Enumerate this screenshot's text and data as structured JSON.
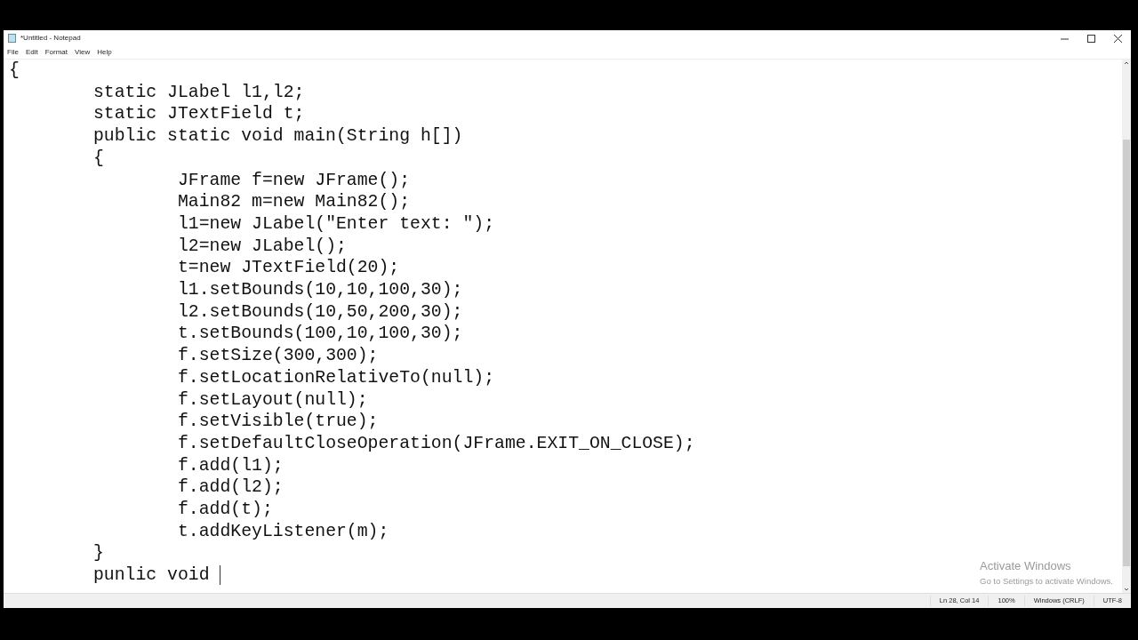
{
  "window": {
    "title": "*Untitled - Notepad"
  },
  "menu": [
    "File",
    "Edit",
    "Format",
    "View",
    "Help"
  ],
  "editor": {
    "lines": [
      "{",
      "\tstatic JLabel l1,l2;",
      "\tstatic JTextField t;",
      "\tpublic static void main(String h[])",
      "\t{",
      "\t\tJFrame f=new JFrame();",
      "\t\tMain82 m=new Main82();",
      "\t\tl1=new JLabel(\"Enter text: \");",
      "\t\tl2=new JLabel();",
      "\t\tt=new JTextField(20);",
      "\t\tl1.setBounds(10,10,100,30);",
      "\t\tl2.setBounds(10,50,200,30);",
      "\t\tt.setBounds(100,10,100,30);",
      "\t\tf.setSize(300,300);",
      "\t\tf.setLocationRelativeTo(null);",
      "\t\tf.setLayout(null);",
      "\t\tf.setVisible(true);",
      "\t\tf.setDefaultCloseOperation(JFrame.EXIT_ON_CLOSE);",
      "\t\tf.add(l1);",
      "\t\tf.add(l2);",
      "\t\tf.add(t);",
      "\t\tt.addKeyListener(m);",
      "\t}",
      "\tpunlic void "
    ]
  },
  "activation": {
    "title": "Activate Windows",
    "subtitle": "Go to Settings to activate Windows."
  },
  "status_bar": [
    "Ln 28, Col 14",
    "100%",
    "Windows (CRLF)",
    "UTF-8"
  ]
}
